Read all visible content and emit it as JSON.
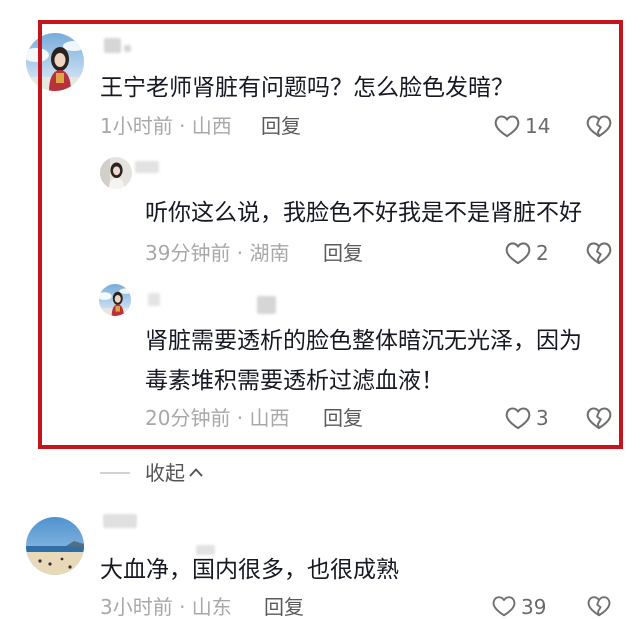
{
  "highlight": {
    "color": "#c5151c"
  },
  "colors": {
    "text": "#161823",
    "meta": "#a8a8a8",
    "action": "#5a5a5a",
    "icon": "#6f6f6f"
  },
  "icons": {
    "like": "heart-outline-icon",
    "dislike": "broken-heart-icon",
    "collapse": "chevron-up-icon"
  },
  "thread": {
    "comment": {
      "avatar": "avatar-woman-blue-sky",
      "lines": [
        "王宁老师肾脏有问题吗？怎么脸色发暗？"
      ],
      "meta": "1小时前 · 山西",
      "reply_label": "回复",
      "likes": 14
    },
    "replies": [
      {
        "avatar": "avatar-woman-light",
        "lines": [
          "听你这么说，我脸色不好我是不是肾脏不好"
        ],
        "meta": "39分钟前 · 湖南",
        "reply_label": "回复",
        "likes": 2
      },
      {
        "avatar": "avatar-woman-blue-sky",
        "lines": [
          "肾脏需要透析的脸色整体暗沉无光泽，因为",
          "毒素堆积需要透析过滤血液！"
        ],
        "meta": "20分钟前 · 山西",
        "reply_label": "回复",
        "likes": 3
      }
    ],
    "collapse_label": "收起"
  },
  "next_comment": {
    "avatar": "avatar-beach",
    "lines": [
      "大血净，国内很多，也很成熟"
    ],
    "meta": "3小时前 · 山东",
    "reply_label": "回复",
    "likes": 39
  }
}
